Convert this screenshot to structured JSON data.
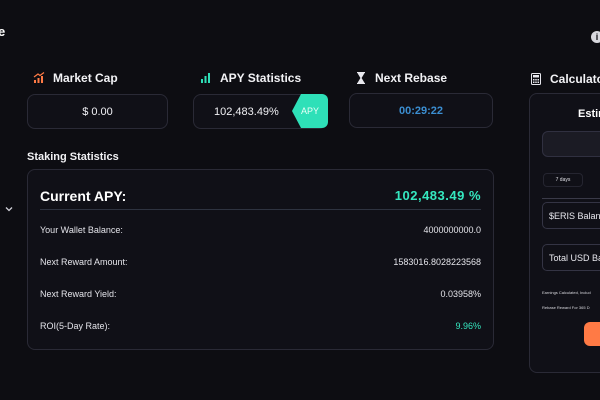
{
  "header": {
    "title_fragment": "e",
    "info_icon": "info-icon"
  },
  "stats": {
    "market_cap": {
      "label": "Market Cap",
      "value": "$ 0.00",
      "icon": "bar-chart-up-icon",
      "icon_color": "#ff7a45"
    },
    "apy": {
      "label": "APY Statistics",
      "value": "102,483.49%",
      "badge": "APY",
      "icon": "bar-chart-icon",
      "icon_color": "#2ee0b8"
    },
    "rebase": {
      "label": "Next Rebase",
      "value": "00:29:22",
      "icon": "hourglass-icon"
    }
  },
  "staking": {
    "title": "Staking Statistics",
    "current_apy_label": "Current APY:",
    "current_apy_value": "102,483.49 %",
    "rows": [
      {
        "label": "Your Wallet Balance:",
        "value": "4000000000.0"
      },
      {
        "label": "Next Reward Amount:",
        "value": "1583016.8028223568"
      },
      {
        "label": "Next Reward Yield:",
        "value": "0.03958%"
      },
      {
        "label": "ROI(5-Day Rate):",
        "value": "9.96%"
      }
    ]
  },
  "calculator": {
    "header": "Calculator",
    "title": "Estim",
    "days": "7 days",
    "field1": "$ERIS Balance",
    "field2": "Total USD Ba",
    "note1": "Earnings Calculated, Includ",
    "note2": "Rebase Reward For 365 D"
  },
  "colors": {
    "accent_teal": "#35e8c0",
    "accent_orange": "#ff7a45",
    "timer_blue": "#3b8ed1",
    "background": "#0d0d12"
  }
}
